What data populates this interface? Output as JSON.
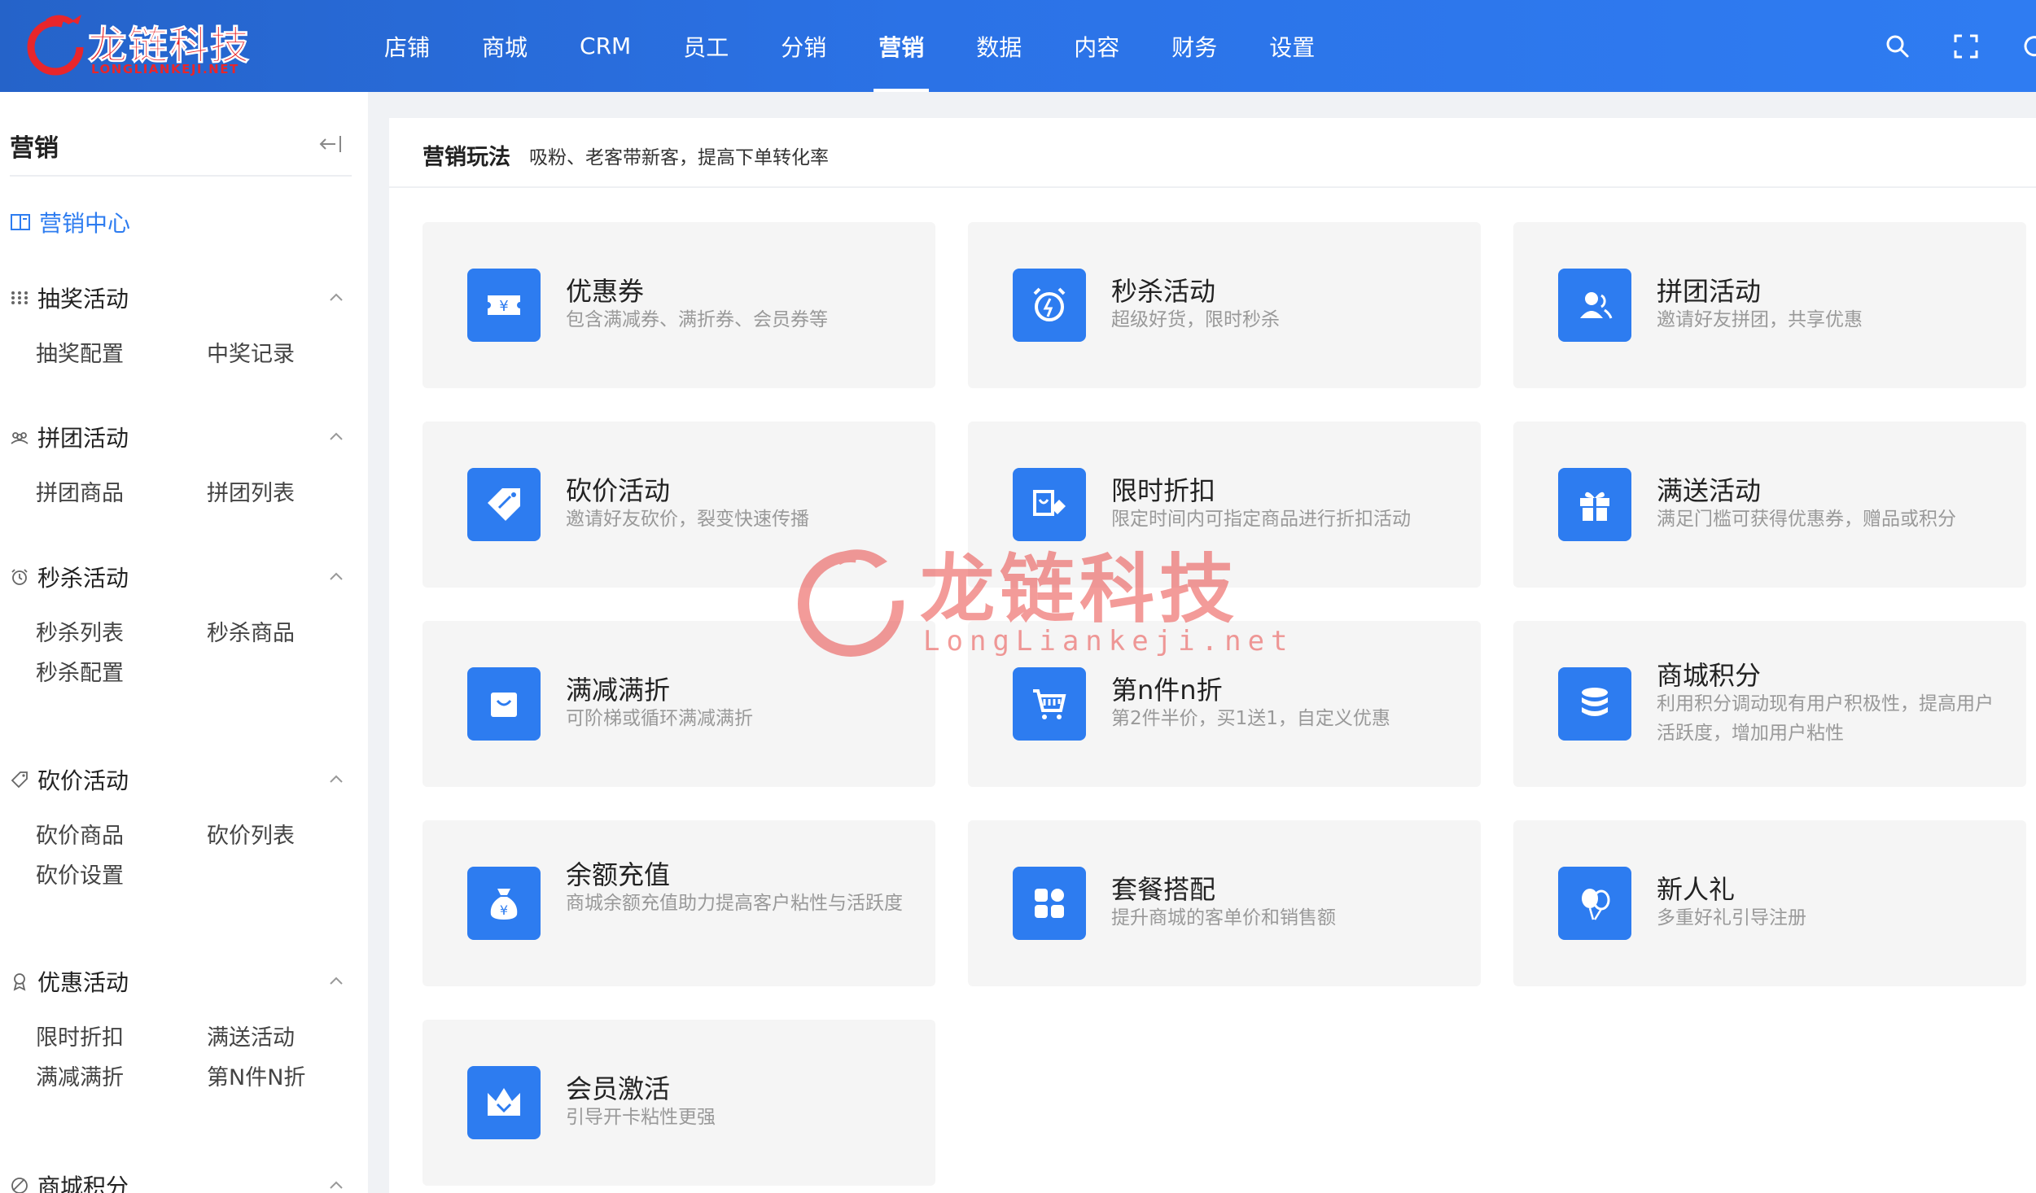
{
  "logo": {
    "cn": "龙链科技",
    "en": "LONGLIANKEJI.NET"
  },
  "nav": {
    "items": [
      "店铺",
      "商城",
      "CRM",
      "员工",
      "分销",
      "营销",
      "数据",
      "内容",
      "财务",
      "设置"
    ],
    "active_index": 5
  },
  "top_icons": [
    "search-icon",
    "fullscreen-icon",
    "refresh-icon"
  ],
  "sidebar": {
    "title": "营销",
    "active_item": "营销中心",
    "groups": [
      {
        "label": "抽奖活动",
        "icon": "grid-dots-icon",
        "items": [
          "抽奖配置",
          "中奖记录"
        ]
      },
      {
        "label": "拼团活动",
        "icon": "group-icon",
        "items": [
          "拼团商品",
          "拼团列表"
        ]
      },
      {
        "label": "秒杀活动",
        "icon": "alarm-icon",
        "items": [
          "秒杀列表",
          "秒杀商品",
          "秒杀配置"
        ]
      },
      {
        "label": "砍价活动",
        "icon": "tag-icon",
        "items": [
          "砍价商品",
          "砍价列表",
          "砍价设置"
        ]
      },
      {
        "label": "优惠活动",
        "icon": "medal-icon",
        "items": [
          "限时折扣",
          "满送活动",
          "满减满折",
          "第N件N折"
        ]
      },
      {
        "label": "商城积分",
        "icon": "coin-icon",
        "items": []
      }
    ]
  },
  "main": {
    "title": "营销玩法",
    "subtitle": "吸粉、老客带新客，提高下单转化率",
    "cards": [
      {
        "title": "优惠券",
        "desc": "包含满减券、满折券、会员券等",
        "icon": "coupon-icon"
      },
      {
        "title": "秒杀活动",
        "desc": "超级好货，限时秒杀",
        "icon": "alarm-clock-icon"
      },
      {
        "title": "拼团活动",
        "desc": "邀请好友拼团，共享优惠",
        "icon": "users-icon"
      },
      {
        "title": "砍价活动",
        "desc": "邀请好友砍价，裂变快速传播",
        "icon": "price-tag-icon"
      },
      {
        "title": "限时折扣",
        "desc": "限定时间内可指定商品进行折扣活动",
        "icon": "discount-tag-icon"
      },
      {
        "title": "满送活动",
        "desc": "满足门槛可获得优惠券，赠品或积分",
        "icon": "gift-icon"
      },
      {
        "title": "满减满折",
        "desc": "可阶梯或循环满减满折",
        "icon": "shopping-bag-icon"
      },
      {
        "title": "第n件n折",
        "desc": "第2件半价，买1送1，自定义优惠",
        "icon": "cart-icon"
      },
      {
        "title": "商城积分",
        "desc": "利用积分调动现有用户积极性，提高用户活跃度，增加用户粘性",
        "icon": "points-stack-icon"
      },
      {
        "title": "余额充值",
        "desc": "商城余额充值助力提高客户粘性与活跃度",
        "icon": "money-bag-icon"
      },
      {
        "title": "套餐搭配",
        "desc": "提升商城的客单价和销售额",
        "icon": "bundle-icon"
      },
      {
        "title": "新人礼",
        "desc": "多重好礼引导注册",
        "icon": "balloon-icon"
      },
      {
        "title": "会员激活",
        "desc": "引导开卡粘性更强",
        "icon": "crown-icon"
      }
    ]
  },
  "watermark": {
    "cn": "龙链科技",
    "en": "LongLiankeji.net"
  },
  "colors": {
    "primary": "#2d7cf0",
    "nav_bg": "#2b72e6",
    "brand_red": "#e8262b",
    "card_bg": "#f5f5f5"
  }
}
